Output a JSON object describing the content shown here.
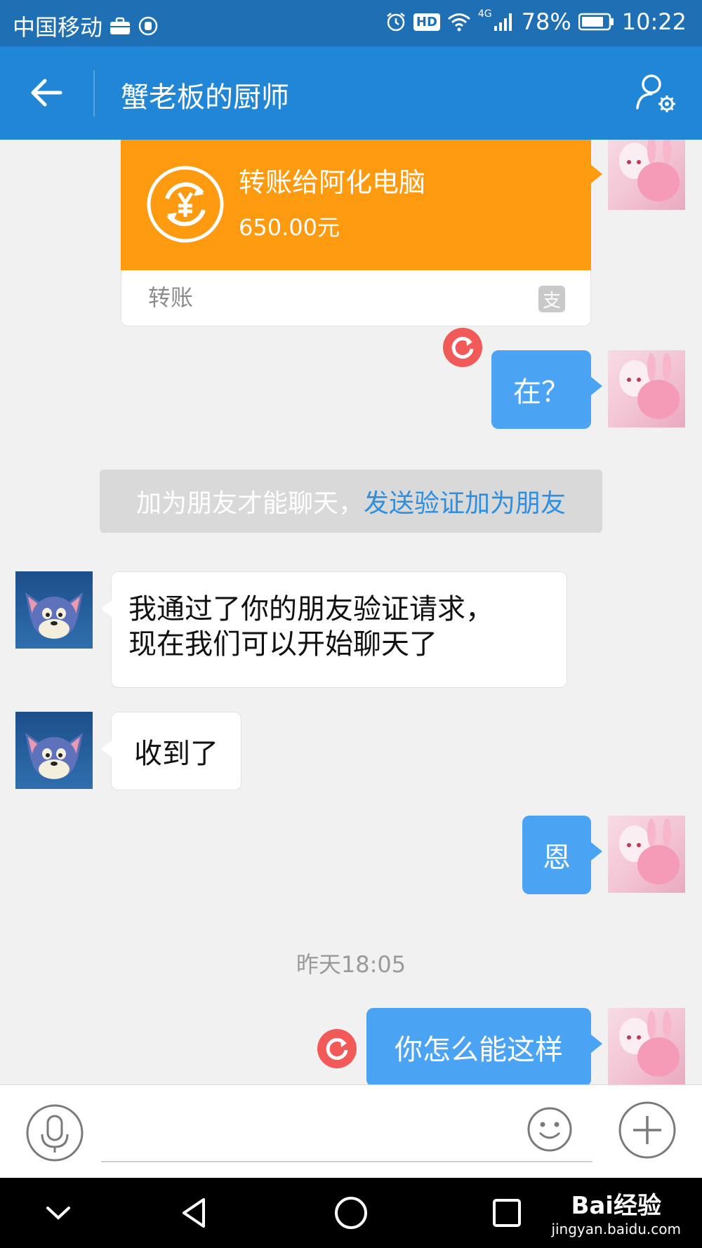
{
  "status_bar": {
    "carrier": "中国移动",
    "network": "4G",
    "battery": "78%",
    "time": "10:22",
    "hd": "HD"
  },
  "header": {
    "title": "蟹老板的厨师"
  },
  "messages": {
    "transfer": {
      "title": "转账给阿化电脑",
      "amount": "650.00元",
      "label": "转账",
      "pay_icon_char": "支"
    },
    "msg1": "在？",
    "notice_text": "加为朋友才能聊天，",
    "notice_link": "发送验证加为朋友",
    "incoming1_line1": "我通过了你的朋友验证请求，",
    "incoming1_line2": "现在我们可以开始聊天了",
    "incoming2": "收到了",
    "msg2": "恩",
    "timestamp": "昨天18:05",
    "msg3": "你怎么能这样"
  },
  "input": {
    "placeholder": ""
  },
  "watermark": {
    "logo": "Bai经验",
    "url": "jingyan.baidu.com"
  },
  "colors": {
    "status_bar": "#1f6fb4",
    "title_bar": "#2286d6",
    "outgoing_bubble": "#4aa3f3",
    "transfer_orange": "#fe9a10",
    "resend_red": "#f25a5a",
    "link_blue": "#2c8fe0"
  }
}
